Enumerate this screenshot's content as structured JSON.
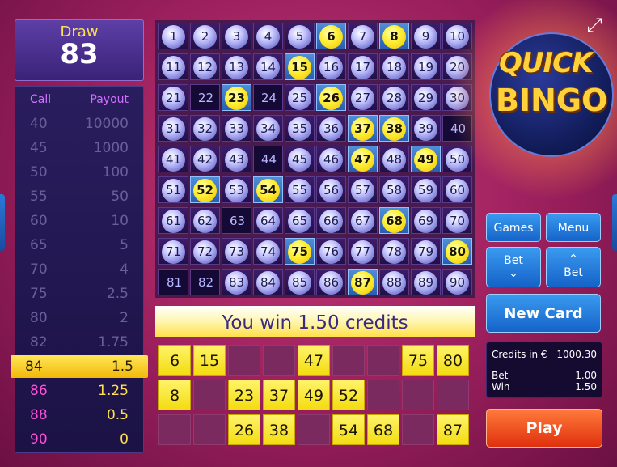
{
  "draw": {
    "label": "Draw",
    "value": "83"
  },
  "paytable": {
    "header": {
      "call": "Call",
      "payout": "Payout"
    },
    "rows": [
      {
        "call": "40",
        "payout": "10000",
        "state": "normal"
      },
      {
        "call": "45",
        "payout": "1000",
        "state": "normal"
      },
      {
        "call": "50",
        "payout": "100",
        "state": "normal"
      },
      {
        "call": "55",
        "payout": "50",
        "state": "normal"
      },
      {
        "call": "60",
        "payout": "10",
        "state": "normal"
      },
      {
        "call": "65",
        "payout": "5",
        "state": "normal"
      },
      {
        "call": "70",
        "payout": "4",
        "state": "normal"
      },
      {
        "call": "75",
        "payout": "2.5",
        "state": "normal"
      },
      {
        "call": "80",
        "payout": "2",
        "state": "normal"
      },
      {
        "call": "82",
        "payout": "1.75",
        "state": "normal"
      },
      {
        "call": "84",
        "payout": "1.5",
        "state": "active"
      },
      {
        "call": "86",
        "payout": "1.25",
        "state": "highlight"
      },
      {
        "call": "88",
        "payout": "0.5",
        "state": "highlight"
      },
      {
        "call": "90",
        "payout": "0",
        "state": "highlight"
      }
    ]
  },
  "grid": {
    "selected": [
      6,
      8,
      15,
      23,
      26,
      37,
      38,
      47,
      49,
      52,
      54,
      68,
      75,
      80,
      87
    ],
    "hit_cells": [
      6,
      8,
      15,
      23,
      26,
      37,
      38,
      47,
      49,
      52,
      54,
      68,
      75,
      80,
      87
    ],
    "undrawn": [
      22,
      24,
      40,
      44,
      63,
      81,
      82
    ]
  },
  "win_banner": "You win 1.50 credits",
  "card": {
    "rows": [
      [
        "6",
        "15",
        "",
        "",
        "47",
        "",
        "",
        "75",
        "80"
      ],
      [
        "8",
        "",
        "23",
        "37",
        "49",
        "52",
        "",
        "",
        ""
      ],
      [
        "",
        "",
        "26",
        "38",
        "",
        "54",
        "68",
        "",
        "87"
      ]
    ]
  },
  "buttons": {
    "games": "Games",
    "menu": "Menu",
    "bet_down": "Bet",
    "bet_up": "Bet",
    "new_card": "New Card",
    "play": "Play"
  },
  "credits": {
    "label": "Credits in €",
    "value": "1000.30",
    "bet_label": "Bet",
    "bet_value": "1.00",
    "win_label": "Win",
    "win_value": "1.50"
  },
  "logo": {
    "line1": "QUICK",
    "line2": "BINGO"
  },
  "icons": {
    "expand": "expand-icon",
    "bet_down_arrow": "chevron-down-icon",
    "bet_up_arrow": "chevron-up-icon"
  }
}
